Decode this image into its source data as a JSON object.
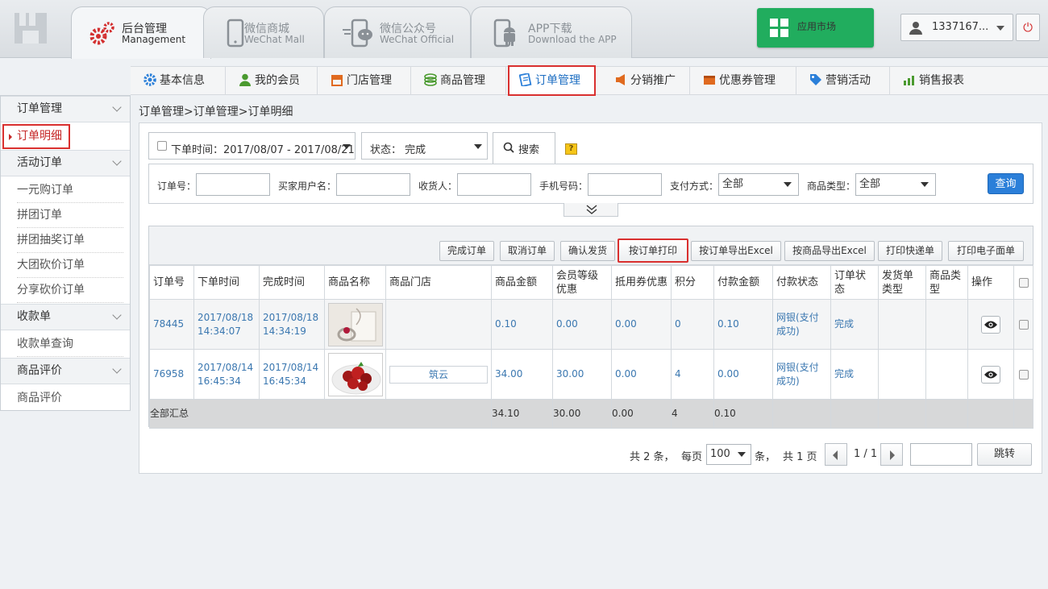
{
  "top_tabs": [
    {
      "title": "后台管理",
      "subtitle": "Management"
    },
    {
      "title": "微信商城",
      "subtitle": "WeChat Mall"
    },
    {
      "title": "微信公众号",
      "subtitle": "WeChat Official"
    },
    {
      "title": "APP下载",
      "subtitle": "Download the APP"
    }
  ],
  "market_label": "应用市场",
  "user": {
    "name": "1337167..."
  },
  "nav": [
    "基本信息",
    "我的会员",
    "门店管理",
    "商品管理",
    "订单管理",
    "分销推广",
    "优惠券管理",
    "营销活动",
    "销售报表"
  ],
  "sidebar": {
    "groups": [
      "订单管理",
      "活动订单",
      "收款单",
      "商品评价"
    ],
    "items": [
      "订单明细",
      "一元购订单",
      "拼团订单",
      "拼团抽奖订单",
      "大团砍价订单",
      "分享砍价订单",
      "收款单查询",
      "商品评价"
    ]
  },
  "breadcrumb": "订单管理>订单管理>订单明细",
  "filters": {
    "date_range": "下单时间：2017/08/07 - 2017/08/21",
    "status": "状态：  完成",
    "search_tab": "搜索",
    "help": "?",
    "order_no": "订单号：",
    "buyer": "买家用户名：",
    "receiver": "收货人：",
    "phone": "手机号码：",
    "pay_method": "支付方式：",
    "pay_method_value": "全部",
    "goods_type": "商品类型：",
    "goods_type_value": "全部",
    "query": "查询"
  },
  "actions": [
    "完成订单",
    "取消订单",
    "确认发货",
    "按订单打印",
    "按订单导出Excel",
    "按商品导出Excel",
    "打印快递单",
    "打印电子面单"
  ],
  "table": {
    "headers": [
      "订单号",
      "下单时间",
      "完成时间",
      "商品名称",
      "商品门店",
      "商品金额",
      "会员等级优惠",
      "抵用券优惠",
      "积分",
      "付款金额",
      "付款状态",
      "订单状态",
      "发货单类型",
      "商品类型",
      "操作"
    ],
    "rows": [
      {
        "order_no": "78445",
        "order_time": "2017/08/18 14:34:07",
        "finish_time": "2017/08/18 14:34:19",
        "store": "",
        "amount": "0.10",
        "member_discount": "0.00",
        "coupon": "0.00",
        "points": "0",
        "paid": "0.10",
        "pay_status": "网银(支付成功)",
        "order_status": "完成"
      },
      {
        "order_no": "76958",
        "order_time": "2017/08/14 16:45:34",
        "finish_time": "2017/08/14 16:45:34",
        "store": "筑云",
        "amount": "34.00",
        "member_discount": "30.00",
        "coupon": "0.00",
        "points": "4",
        "paid": "0.00",
        "pay_status": "网银(支付成功)",
        "order_status": "完成"
      }
    ],
    "summary": {
      "label": "全部汇总",
      "amount": "34.10",
      "member_discount": "30.00",
      "coupon": "0.00",
      "points": "4",
      "paid": "0.10"
    }
  },
  "pager": {
    "total": "共 2 条，",
    "per_page_label": "每页",
    "per_page": "100",
    "unit": "条，",
    "pages": "共 1 页",
    "current": "1 / 1",
    "go": "跳转"
  }
}
